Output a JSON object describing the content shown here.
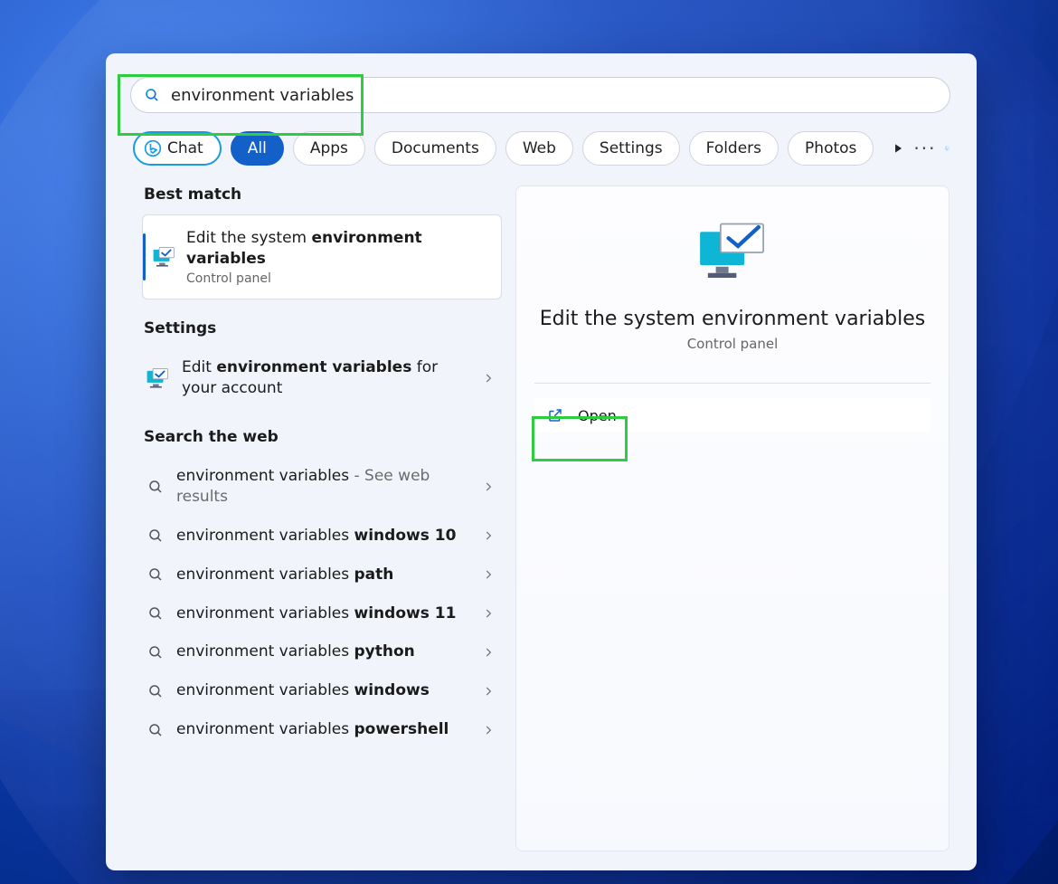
{
  "search": {
    "value": "environment variables"
  },
  "filters": {
    "chat": "Chat",
    "items": [
      {
        "label": "All",
        "active": true
      },
      {
        "label": "Apps",
        "active": false
      },
      {
        "label": "Documents",
        "active": false
      },
      {
        "label": "Web",
        "active": false
      },
      {
        "label": "Settings",
        "active": false
      },
      {
        "label": "Folders",
        "active": false
      },
      {
        "label": "Photos",
        "active": false
      }
    ]
  },
  "left": {
    "bestMatch": {
      "heading": "Best match",
      "title_prefix": "Edit the system ",
      "title_bold": "environment variables",
      "subtitle": "Control panel"
    },
    "settings": {
      "heading": "Settings",
      "item_prefix": "Edit ",
      "item_bold": "environment variables",
      "item_suffix": " for your account"
    },
    "web": {
      "heading": "Search the web",
      "items": [
        {
          "plain": "environment variables",
          "bold": "",
          "suffix": " - See web results"
        },
        {
          "plain": "environment variables ",
          "bold": "windows 10",
          "suffix": ""
        },
        {
          "plain": "environment variables ",
          "bold": "path",
          "suffix": ""
        },
        {
          "plain": "environment variables ",
          "bold": "windows 11",
          "suffix": ""
        },
        {
          "plain": "environment variables ",
          "bold": "python",
          "suffix": ""
        },
        {
          "plain": "environment variables ",
          "bold": "windows",
          "suffix": ""
        },
        {
          "plain": "environment variables ",
          "bold": "powershell",
          "suffix": ""
        }
      ]
    }
  },
  "right": {
    "title": "Edit the system environment variables",
    "subtitle": "Control panel",
    "open": "Open"
  }
}
